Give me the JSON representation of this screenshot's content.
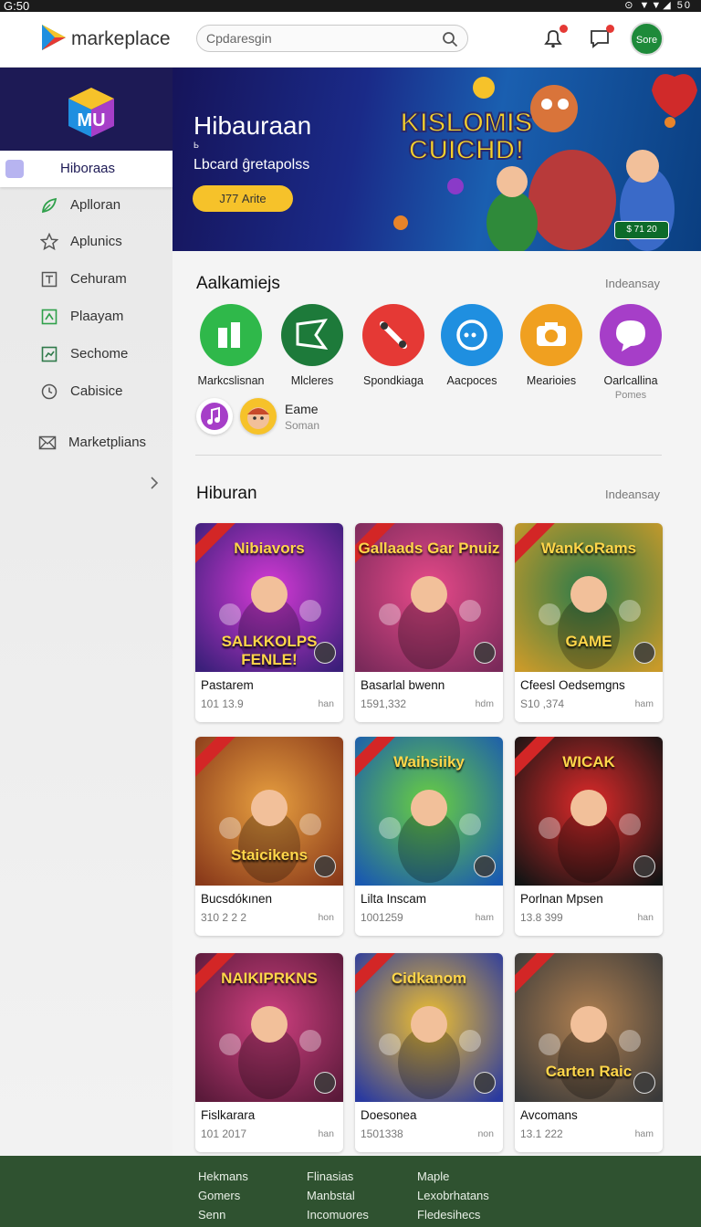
{
  "status_bar": {
    "time": "G:50",
    "icons": "⊙ ▼▼◢ 50"
  },
  "header": {
    "app_name": "markeplace",
    "search_placeholder": "Cpdaresgin",
    "store_button": "Sore",
    "colors": {
      "brand_green": "#1e8a3a",
      "notification": "#e53935"
    }
  },
  "sidebar": {
    "items": [
      {
        "label": "Hiboraas",
        "icon": "square-icon",
        "active": true
      },
      {
        "label": "Aplloran",
        "icon": "leaf-icon"
      },
      {
        "label": "Aplunics",
        "icon": "star-icon"
      },
      {
        "label": "Cehuram",
        "icon": "text-box-icon"
      },
      {
        "label": "Plaayam",
        "icon": "puzzle-icon"
      },
      {
        "label": "Sechome",
        "icon": "chart-icon"
      },
      {
        "label": "Cabisice",
        "icon": "clock-icon"
      },
      {
        "label": "Marketplians",
        "icon": "mail-icon"
      }
    ]
  },
  "hero": {
    "title": "Hibauraan",
    "mini_label": "Ь",
    "subtitle": "Lbcard ĝretapolss",
    "button": "Ј77 Arite",
    "art_title_1": "KISLOMIS",
    "art_title_2": "CUICHD!",
    "badge": "$ 71 20"
  },
  "categories_section": {
    "title": "Aalkamiejs",
    "link": "Indeansay",
    "items": [
      {
        "name": "Markcslisnan",
        "color": "#2fb84a",
        "icon": "bars-icon"
      },
      {
        "name": "Mlcleres",
        "color": "#1d7a3a",
        "icon": "flag-icon"
      },
      {
        "name": "Spondkiaga",
        "color": "#e53935",
        "icon": "pencil-icon"
      },
      {
        "name": "Aacpoces",
        "color": "#1f8fe0",
        "icon": "chat-icon"
      },
      {
        "name": "Mearioies",
        "color": "#f0a020",
        "icon": "camera-icon"
      },
      {
        "name": "Oarlcallina",
        "sub": "Pomes",
        "color": "#a63ec8",
        "icon": "speech-icon"
      }
    ],
    "extra": {
      "label": "Eame",
      "sub": "Soman"
    }
  },
  "games_section": {
    "title": "Hiburan",
    "link": "Indeansay",
    "cards": [
      {
        "art": "Nibiavors",
        "art2": "SALKKOLPS FENLE!",
        "name": "Pastarem",
        "num": "101 13.9",
        "unit": "han",
        "bg": "#3b1f7a",
        "accent": "#d63ad6"
      },
      {
        "art": "Gallaads Gar Pnuiz",
        "art2": "",
        "name": "Basarlal bwenn",
        "num": "1591,332",
        "unit": "hdm",
        "bg": "#7a2a5a",
        "accent": "#e84a8a"
      },
      {
        "art": "WanKoRams",
        "art2": "GAME",
        "name": "Cfeesl Oedsemgns",
        "num": "S10 ,374",
        "unit": "ham",
        "bg": "#c99a2a",
        "accent": "#2a7a4a"
      },
      {
        "art": "",
        "art2": "Staicikens",
        "name": "Bucsdókınen",
        "num": "310 2 2 2",
        "unit": "hon",
        "bg": "#8a3a1a",
        "accent": "#e8a040"
      },
      {
        "art": "Waihsiiky",
        "art2": "",
        "name": "Lilta Inscam",
        "num": "1001259",
        "unit": "ham",
        "bg": "#1a5ab0",
        "accent": "#6ad040"
      },
      {
        "art": "WICAK",
        "art2": "",
        "name": "Porlnan Mpsen",
        "num": "13.8 399",
        "unit": "han",
        "bg": "#141414",
        "accent": "#e02a2a"
      },
      {
        "art": "NAIKIPRKNS",
        "art2": "",
        "name": "Fislkarara",
        "num": "101 2017",
        "unit": "han",
        "bg": "#5a1a3a",
        "accent": "#d04080"
      },
      {
        "art": "Cidkanom",
        "art2": "",
        "name": "Doesonea",
        "num": "1501338",
        "unit": "non",
        "bg": "#2a3aa0",
        "accent": "#f0c030"
      },
      {
        "art": "",
        "art2": "Carten Raic",
        "name": "Avcomans",
        "num": "13.1 222",
        "unit": "ham",
        "bg": "#3a3a3a",
        "accent": "#b08050"
      }
    ]
  },
  "footer": {
    "columns": [
      [
        "Hekmans",
        "Gomers",
        "Senn"
      ],
      [
        "Flinasias",
        "Manbstal",
        "Incomuores"
      ],
      [
        "Maple",
        "Lexobrhatans",
        "Fledesihecs"
      ]
    ],
    "color": "#2f5230"
  }
}
